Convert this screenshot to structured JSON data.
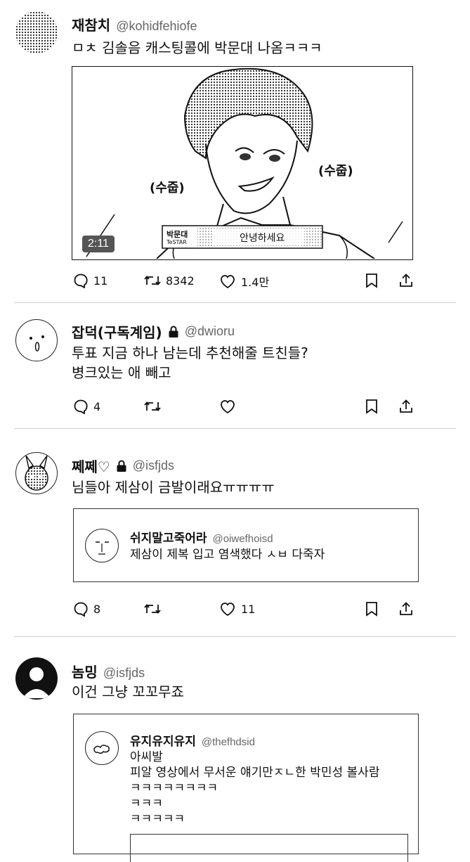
{
  "posts": [
    {
      "name": "재참치",
      "handle": "@kohidfehiofe",
      "text": "ㅁㅊ 김솔음 캐스팅콜에 박문대 나옴ㅋㅋㅋ",
      "media": {
        "duration": "2:11",
        "caption_name": "박문대",
        "caption_sub": "TeSTAR",
        "caption_text": "안녕하세요",
        "sfx_left": "(수줍)",
        "sfx_right": "(수줍)"
      },
      "replies": "11",
      "reposts": "8342",
      "likes": "1.4만"
    },
    {
      "name": "잡덕(구독계임)",
      "handle": "@dwioru",
      "text_lines": [
        "투표 지금 하나 남는데 추천해줄 트친들?",
        "병크있는 애 빼고"
      ],
      "replies": "4",
      "reposts": "",
      "likes": ""
    },
    {
      "name": "쩨쩨♡",
      "handle": "@isfjds",
      "text": "님들아 제삼이 금발이래요ㅠㅠㅠㅠ",
      "quote": {
        "name": "쉬지말고죽어라",
        "handle": "@oiwefhoisd",
        "text": "제삼이 제복 입고 염색했다 ㅅㅂ 다죽자"
      },
      "replies": "8",
      "reposts": "",
      "likes": "11"
    },
    {
      "name": "놈밍",
      "handle": "@isfjds",
      "text": "이건 그냥 꼬꼬무죠",
      "quote": {
        "name": "유지유지유지",
        "handle": "@thefhdsid",
        "lines": [
          "아씨발",
          "피알 영상에서 무서운 얘기만ㅈㄴ한 박민성 볼사람",
          "ㅋㅋㅋㅋㅋㅋㅋㅋ",
          "ㅋㅋㅋ",
          "ㅋㅋㅋㅋㅋ"
        ]
      }
    }
  ]
}
